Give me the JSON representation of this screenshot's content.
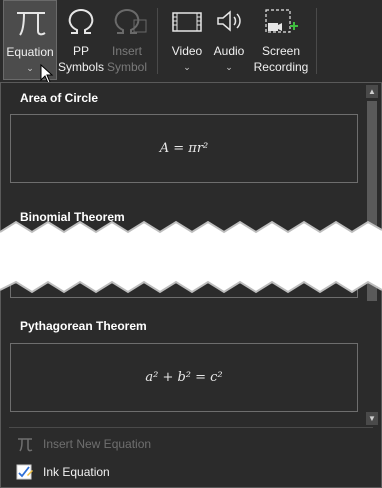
{
  "ribbon": {
    "buttons": [
      {
        "id": "equation",
        "label": "Equation",
        "icon": "pi-icon",
        "state": "active",
        "has_dropdown": true
      },
      {
        "id": "pp_symbols",
        "label_line1": "PP",
        "label_line2": "Symbols",
        "icon": "omega-icon",
        "state": "enabled"
      },
      {
        "id": "insert_symbol",
        "label_line1": "Insert",
        "label_line2": "Symbol",
        "icon": "omega-icon",
        "state": "disabled"
      },
      {
        "id": "video",
        "label": "Video",
        "icon": "film-icon",
        "state": "enabled",
        "has_dropdown": true
      },
      {
        "id": "audio",
        "label": "Audio",
        "icon": "speaker-icon",
        "state": "enabled",
        "has_dropdown": true
      },
      {
        "id": "screen_recording",
        "label_line1": "Screen",
        "label_line2": "Recording",
        "icon": "screen-recording-icon",
        "state": "enabled"
      }
    ]
  },
  "gallery": {
    "sections": [
      {
        "title": "Area of Circle",
        "equation": "A = πr²"
      },
      {
        "title": "Binomial Theorem"
      },
      {
        "title": "Pythagorean Theorem",
        "equation": "a² + b² = c²"
      }
    ]
  },
  "menu": {
    "insert_new_equation": {
      "label": "Insert New Equation",
      "icon": "pi-icon",
      "enabled": false
    },
    "ink_equation": {
      "label": "Ink Equation",
      "icon": "ink-equation-icon",
      "enabled": true
    }
  },
  "colors": {
    "background": "#2b2b2b",
    "text": "#ffffff",
    "disabled_text": "#6f6f6f",
    "accent_green": "#3fbf3f"
  }
}
